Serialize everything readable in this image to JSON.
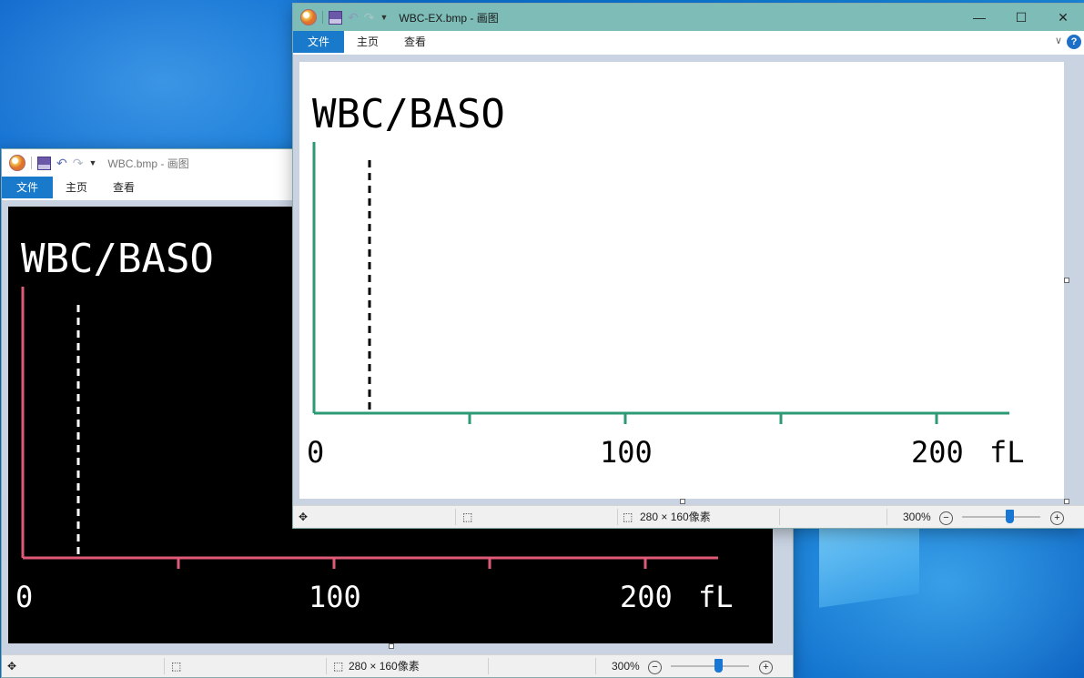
{
  "app_name": "画图",
  "window_back": {
    "title": "WBC.bmp - 画图",
    "tabs": [
      "文件",
      "主页",
      "查看"
    ],
    "image": {
      "heading": "WBC/BASO",
      "axis_labels": [
        "0",
        "100",
        "200",
        "fL"
      ],
      "axis_color": "#e05a78",
      "fg_color": "#ffffff",
      "bg_color": "#000000"
    },
    "status": {
      "image_size": "280 × 160像素",
      "zoom": "300%"
    }
  },
  "window_front": {
    "title": "WBC-EX.bmp - 画图",
    "tabs": [
      "文件",
      "主页",
      "查看"
    ],
    "image": {
      "heading": "WBC/BASO",
      "axis_labels": [
        "0",
        "100",
        "200",
        "fL"
      ],
      "axis_color": "#2e9a74",
      "fg_color": "#000000",
      "bg_color": "#ffffff"
    },
    "status": {
      "image_size": "280 × 160像素",
      "zoom": "300%"
    },
    "title_color": "#7dbcb7"
  },
  "icons": [
    "paint-icon",
    "save-icon",
    "undo-icon",
    "redo-icon",
    "minimize-icon",
    "maximize-icon",
    "close-icon",
    "help-icon",
    "move-icon",
    "selection-icon",
    "zoom-out-icon",
    "zoom-in-icon"
  ]
}
